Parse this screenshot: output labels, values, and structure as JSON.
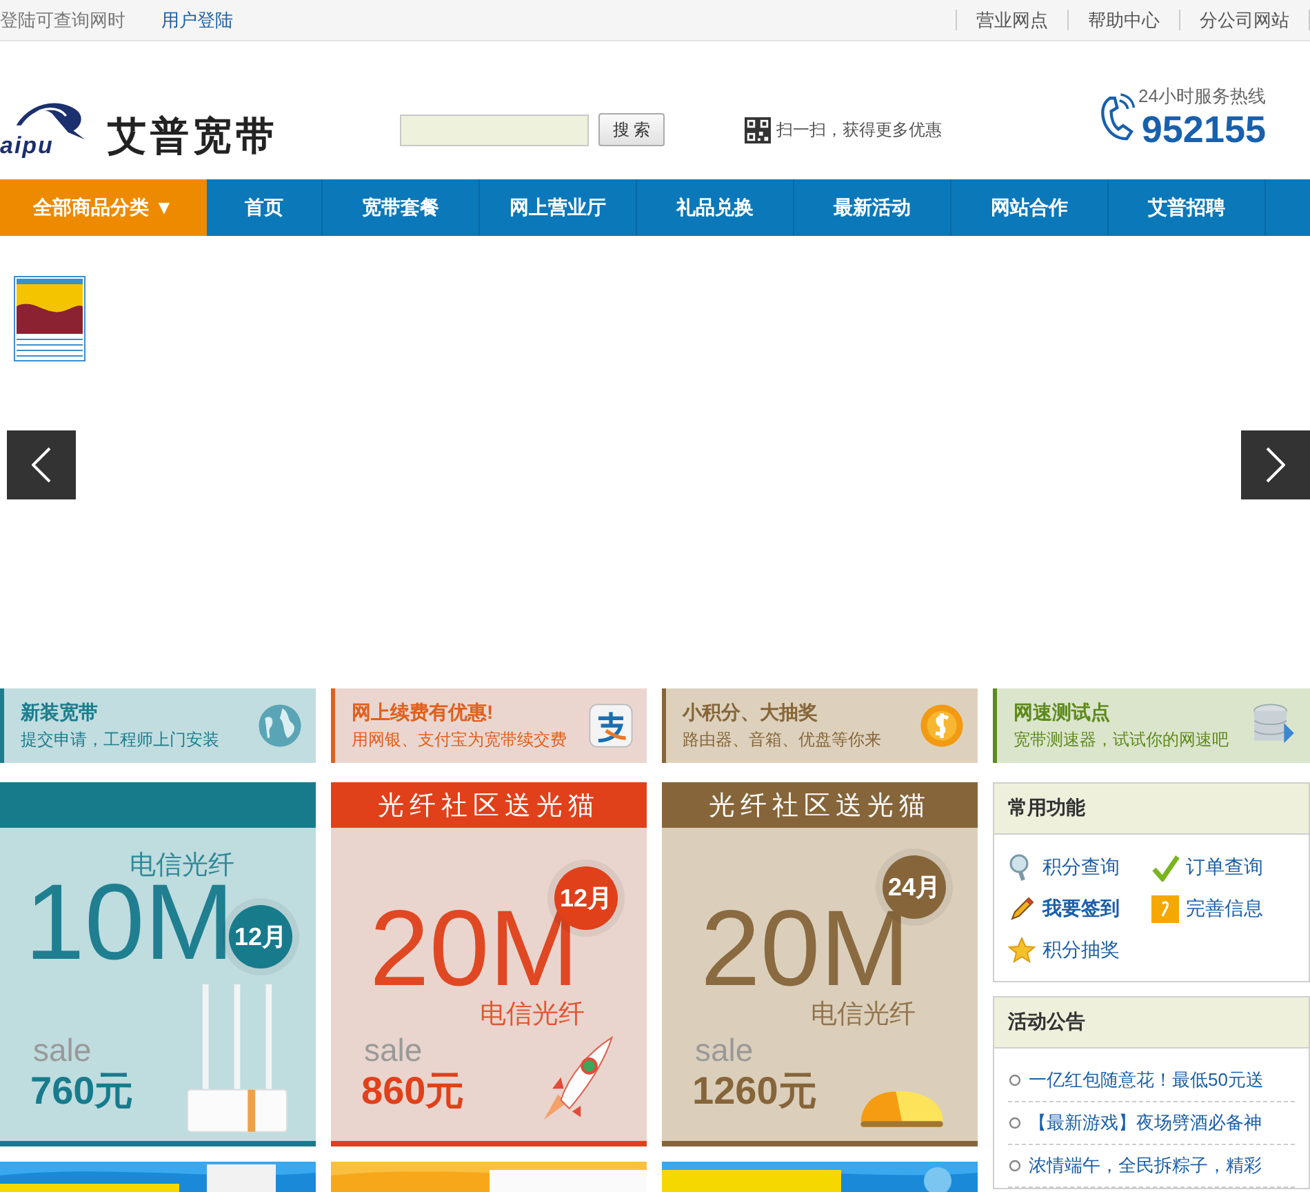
{
  "top_bar": {
    "note": "登陆可查询网时",
    "login_link": "用户登陆",
    "links": [
      "营业网点",
      "帮助中心",
      "分公司网站"
    ]
  },
  "header": {
    "logo_mark": "aipu",
    "logo_text": "艾普宽带",
    "search_button": "搜 索",
    "qr_text": "扫一扫，获得更多优惠",
    "hotline_label": "24小时服务热线",
    "hotline_number": "952155"
  },
  "nav": {
    "items": [
      {
        "label": "全部商品分类",
        "caret": "▼",
        "kind": "category"
      },
      {
        "label": "首页",
        "kind": "link"
      },
      {
        "label": "宽带套餐",
        "kind": "link"
      },
      {
        "label": "网上营业厅",
        "kind": "link"
      },
      {
        "label": "礼品兑换",
        "kind": "link"
      },
      {
        "label": "最新活动",
        "kind": "link"
      },
      {
        "label": "网站合作",
        "kind": "link"
      },
      {
        "label": "艾普招聘",
        "kind": "link"
      }
    ]
  },
  "features": [
    {
      "title": "新装宽带",
      "subtitle": "提交申请，工程师上门安装",
      "color": "#1d7d8c"
    },
    {
      "title": "网上续费有优惠!",
      "subtitle": "用网银、支付宝为宽带续交费",
      "color": "#e0601d"
    },
    {
      "title": "小积分、大抽奖",
      "subtitle": "路由器、音箱、优盘等你来",
      "color": "#86663a"
    },
    {
      "title": "网速测试点",
      "subtitle": "宽带测速器，试试你的网速吧",
      "color": "#5e8a1c"
    }
  ],
  "promos": [
    {
      "subtitle": "电信光纤",
      "speed": "10M",
      "badge": "12月",
      "sale": "sale",
      "price": "760元",
      "color": "#177b8c"
    },
    {
      "header": "光纤社区送光猫",
      "subtitle": "电信光纤",
      "speed": "20M",
      "badge": "12月",
      "sale": "sale",
      "price": "860元",
      "color": "#e0401a"
    },
    {
      "header": "光纤社区送光猫",
      "subtitle": "电信光纤",
      "speed": "20M",
      "badge": "24月",
      "sale": "sale",
      "price": "1260元",
      "color": "#86653a"
    }
  ],
  "functions_panel": {
    "title": "常用功能",
    "items": [
      {
        "label": "积分查询",
        "bold": false
      },
      {
        "label": "订单查询",
        "bold": false
      },
      {
        "label": "我要签到",
        "bold": true
      },
      {
        "label": "完善信息",
        "bold": false
      },
      {
        "label": "积分抽奖",
        "bold": false
      }
    ]
  },
  "notice_panel": {
    "title": "活动公告",
    "items": [
      "一亿红包随意花！最低50元送",
      "【最新游戏】夜场劈酒必备神",
      "浓情端午，全民拆粽子，精彩"
    ]
  }
}
